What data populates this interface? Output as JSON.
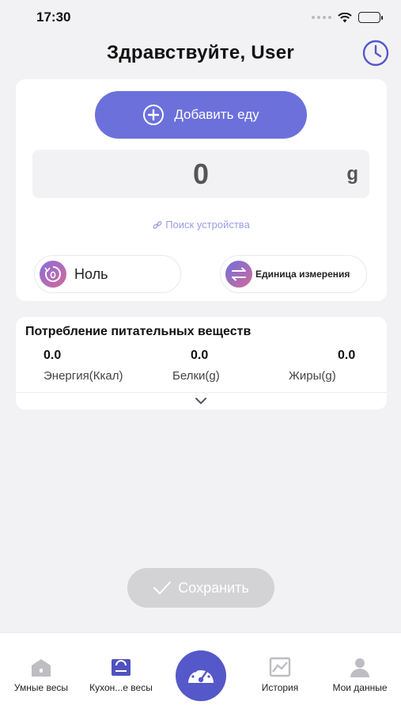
{
  "status": {
    "time": "17:30"
  },
  "header": {
    "title": "Здравствуйте, User"
  },
  "main": {
    "add_food_label": "Добавить еду",
    "weight_value": "0",
    "weight_unit": "g",
    "device_search": "Поиск устройства",
    "zero_label": "Ноль",
    "unit_label": "Единица измерения"
  },
  "nutrition": {
    "title": "Потребление питательных веществ",
    "items": [
      {
        "value": "0.0",
        "label": "Энергия(Ккал)"
      },
      {
        "value": "0.0",
        "label": "Белки(g)"
      },
      {
        "value": "0.0",
        "label": "Жиры(g)"
      }
    ]
  },
  "save_label": "Сохранить",
  "tabs": [
    {
      "label": "Умные весы"
    },
    {
      "label": "Кухон...е весы"
    },
    {
      "label": ""
    },
    {
      "label": "История"
    },
    {
      "label": "Мои данные"
    }
  ],
  "colors": {
    "accent": "#6c70db",
    "accent_dark": "#5558c8",
    "disabled": "#d3d3d6"
  }
}
